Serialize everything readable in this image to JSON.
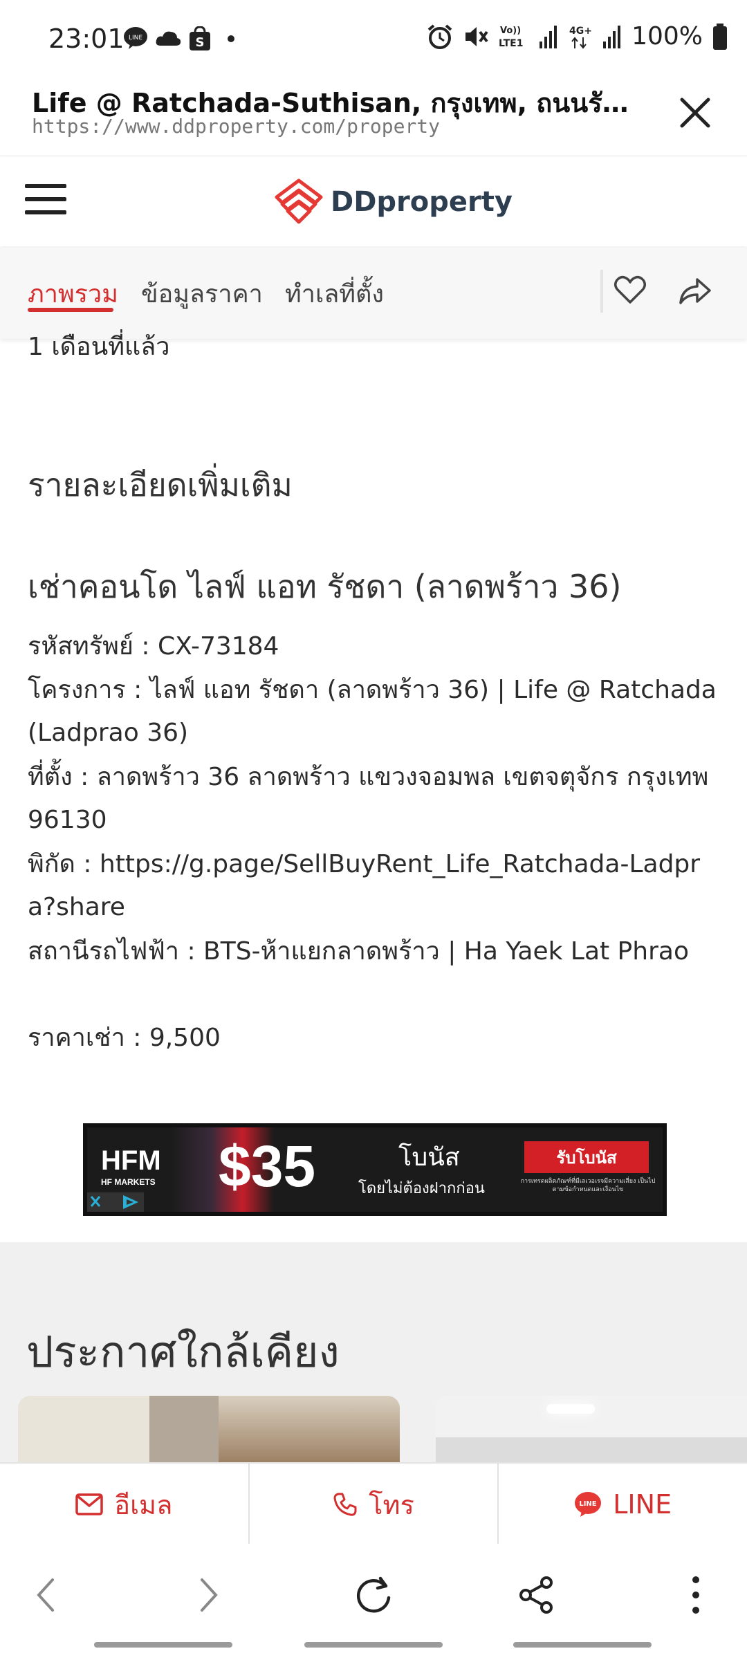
{
  "status_bar": {
    "time": "23:01",
    "battery": "100%",
    "icons": [
      "line-icon",
      "cloud-icon",
      "shopee-icon",
      "dot-icon",
      "alarm-icon",
      "mute-icon",
      "volte-icon",
      "signal-icon",
      "4g-icon",
      "signal-icon",
      "battery-icon"
    ],
    "volte_label": "Vo))\nLTE1",
    "net_label": "4G+"
  },
  "browser": {
    "title": "Life @ Ratchada-Suthisan, กรุงเทพ, ถนนรัชดาภิเษก...",
    "url": "https://www.ddproperty.com/property"
  },
  "header": {
    "logo_text": "DDproperty",
    "brand_color": "#d32f2f"
  },
  "tabs": [
    {
      "label": "ภาพรวม",
      "active": true
    },
    {
      "label": "ข้อมูลราคา",
      "active": false
    },
    {
      "label": "ทำเลที่ตั้ง",
      "active": false
    }
  ],
  "content": {
    "partial_text": "1 เดือนที่แล้ว",
    "section_heading": "รายละเอียดเพิ่มเติม",
    "listing_title": "เช่าคอนโด ไลฟ์ แอท รัชดา (ลาดพร้าว 36)",
    "lines": [
      "รหัสทรัพย์ : CX-73184",
      "โครงการ : ไลฟ์ แอท รัชดา (ลาดพร้าว 36) | Life @ Ratchada (Ladprao 36)",
      "ที่ตั้ง : ลาดพร้าว 36 ลาดพร้าว แขวงจอมพล เขตจตุจักร กรุงเทพ 96130",
      "พิกัด : https://g.page/SellBuyRent_Life_Ratchada-Ladpra?share",
      "สถานีรถไฟฟ้า : BTS-ห้าแยกลาดพร้าว | Ha Yaek Lat Phrao"
    ],
    "price_line": "ราคาเช่า : 9,500"
  },
  "ad": {
    "brand": "HFM",
    "brand_sub": "HF MARKETS",
    "amount": "$35",
    "headline": "โบนัส",
    "subline": "โดยไม่ต้องฝากก่อน",
    "cta": "รับโบนัส",
    "fineprint": "การเทรดผลิตภัณฑ์ที่มีเลเวอเรจมีความเสี่ยง เป็นไปตามข้อกำหนดและเงื่อนไข"
  },
  "nearby": {
    "heading": "ประกาศใกล้เคียง"
  },
  "contact": {
    "email_label": "อีเมล",
    "call_label": "โทร",
    "line_label": "LINE"
  }
}
